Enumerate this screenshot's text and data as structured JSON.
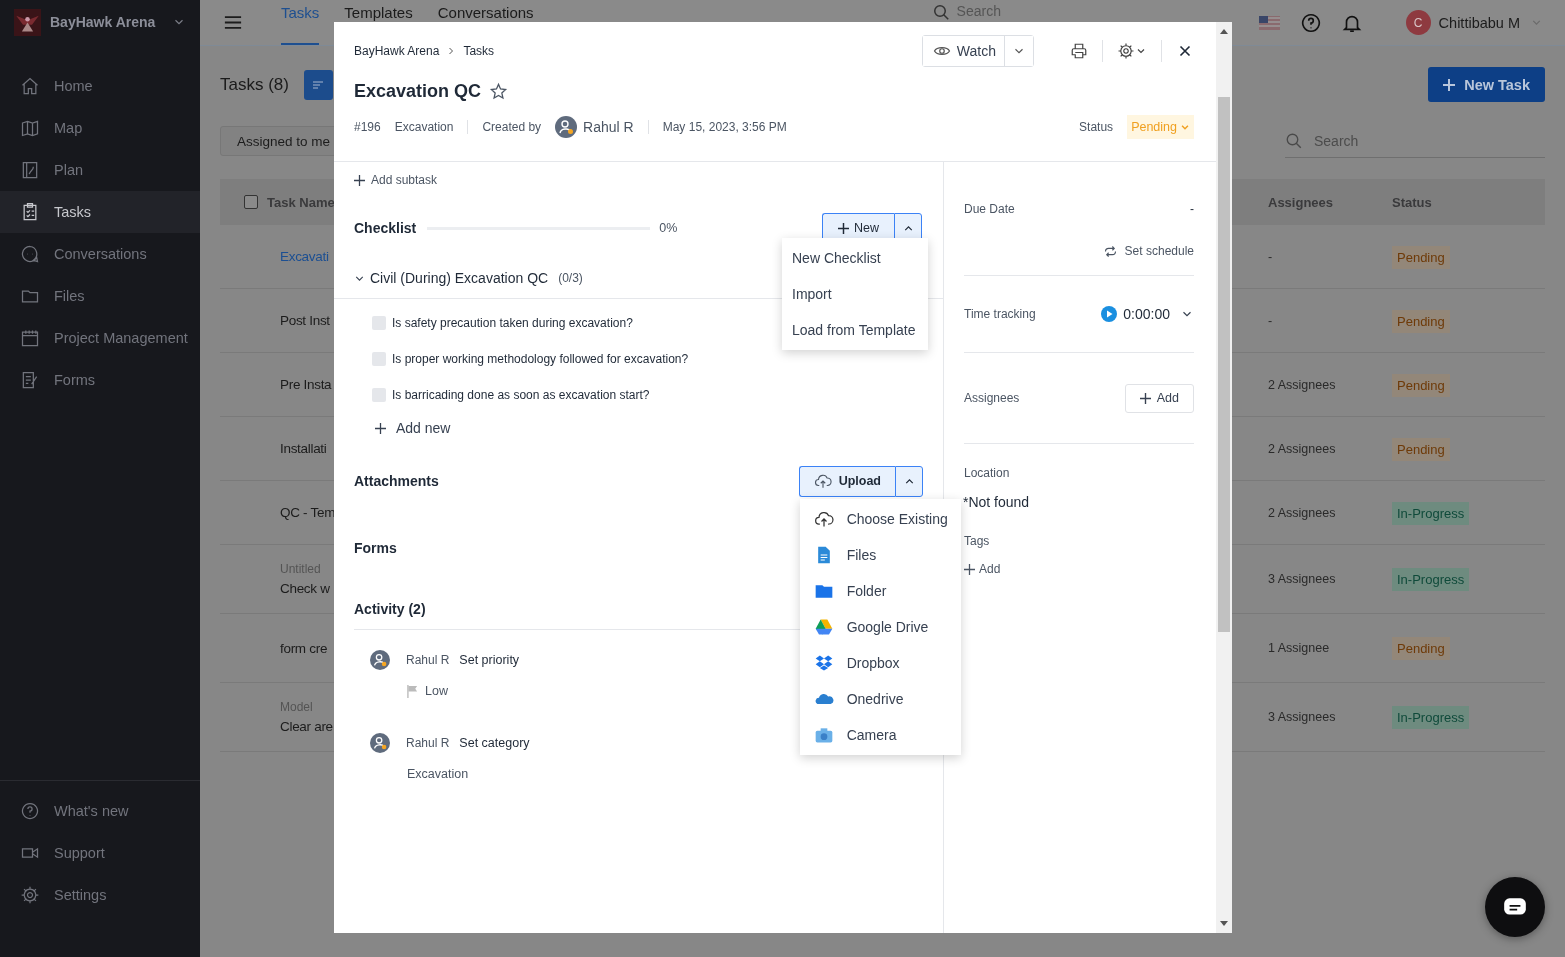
{
  "sidebar": {
    "workspace": "BayHawk Arena",
    "items": [
      {
        "label": "Home",
        "selected": false
      },
      {
        "label": "Map",
        "selected": false
      },
      {
        "label": "Plan",
        "selected": false
      },
      {
        "label": "Tasks",
        "selected": true
      },
      {
        "label": "Conversations",
        "selected": false
      },
      {
        "label": "Files",
        "selected": false
      },
      {
        "label": "Project Management",
        "selected": false
      },
      {
        "label": "Forms",
        "selected": false
      }
    ],
    "footer_items": [
      "What's new",
      "Support",
      "Settings"
    ]
  },
  "topbar": {
    "tabs": [
      {
        "label": "Tasks",
        "selected": true
      },
      {
        "label": "Templates",
        "selected": false
      },
      {
        "label": "Conversations",
        "selected": false
      }
    ],
    "search": {
      "placeholder": "Search"
    },
    "user": {
      "initial": "C",
      "name": "Chittibabu M"
    }
  },
  "page": {
    "title": "Tasks (8)",
    "filter": "Assigned to me",
    "new_button": "New Task",
    "search": {
      "placeholder": "Search"
    },
    "all_selected": false,
    "columns": [
      "Task Name",
      "Assignees",
      "Status"
    ],
    "rows": [
      {
        "name": "Excavati",
        "link": true,
        "assignees": "-",
        "status": {
          "label": "Pending",
          "kind": "pending"
        }
      },
      {
        "name": "Post Inst",
        "link": false,
        "assignees": "-",
        "status": {
          "label": "Pending",
          "kind": "pending"
        }
      },
      {
        "name": "Pre Insta",
        "link": false,
        "assignees": "2 Assignees",
        "status": {
          "label": "Pending",
          "kind": "pending"
        }
      },
      {
        "name": "Installati",
        "link": false,
        "assignees": "2 Assignees",
        "status": {
          "label": "Pending",
          "kind": "pending"
        }
      },
      {
        "name": "QC - Tem",
        "link": false,
        "assignees": "2 Assignees",
        "status": {
          "label": "In-Progress",
          "kind": "progress"
        }
      },
      {
        "subtitle": "Untitled",
        "name": "Check w",
        "link": false,
        "assignees": "3 Assignees",
        "status": {
          "label": "In-Progress",
          "kind": "progress"
        }
      },
      {
        "name": "form cre",
        "link": false,
        "assignees": "1 Assignee",
        "status": {
          "label": "Pending",
          "kind": "pending"
        }
      },
      {
        "subtitle": "Model",
        "name": "Clear are",
        "link": false,
        "assignees": "3 Assignees",
        "status": {
          "label": "In-Progress",
          "kind": "progress"
        }
      }
    ]
  },
  "task": {
    "breadcrumb": [
      "BayHawk Arena",
      "Tasks"
    ],
    "watch": "Watch",
    "title": "Excavation QC",
    "starred": false,
    "number": "#196",
    "category": "Excavation",
    "created_by_label": "Created by",
    "creator": "Rahul R",
    "created_at": "May 15, 2023, 3:56 PM",
    "status_label": "Status",
    "status": "Pending",
    "add_subtask": "Add subtask",
    "checklist": {
      "title": "Checklist",
      "level": 0,
      "percent": "0%",
      "new_button": "New",
      "menu": {
        "open": true,
        "items": [
          "New Checklist",
          "Import",
          "Load from Template"
        ]
      },
      "groups": [
        {
          "name": "Civil (During) Excavation QC",
          "count": "(0/3)",
          "expanded": true,
          "items": [
            {
              "label": "Is safety precaution taken during excavation?",
              "checked": false
            },
            {
              "label": "Is proper working methodology followed for excavation?",
              "checked": false
            },
            {
              "label": "Is barricading done as soon as excavation start?",
              "checked": false
            }
          ]
        }
      ],
      "add_new": "Add new"
    },
    "attachments": {
      "title": "Attachments",
      "upload_button": "Upload",
      "menu": {
        "open": true,
        "items": [
          "Choose Existing",
          "Files",
          "Folder",
          "Google Drive",
          "Dropbox",
          "Onedrive",
          "Camera"
        ]
      }
    },
    "forms": {
      "title": "Forms"
    },
    "activity": {
      "title": "Activity (2)",
      "entries": [
        {
          "user": "Rahul R",
          "action": "Set priority",
          "detail": "Low",
          "kind": "priority"
        },
        {
          "user": "Rahul R",
          "action": "Set category",
          "detail": "Excavation",
          "kind": "category"
        }
      ]
    },
    "details": {
      "due_date_label": "Due Date",
      "due_date": "-",
      "set_schedule": "Set schedule",
      "time_tracking_label": "Time tracking",
      "time": "0:00:00",
      "assignees_label": "Assignees",
      "assignees_add": "Add",
      "location_label": "Location",
      "location": "*Not found",
      "tags_label": "Tags",
      "tags_add": "Add"
    }
  }
}
